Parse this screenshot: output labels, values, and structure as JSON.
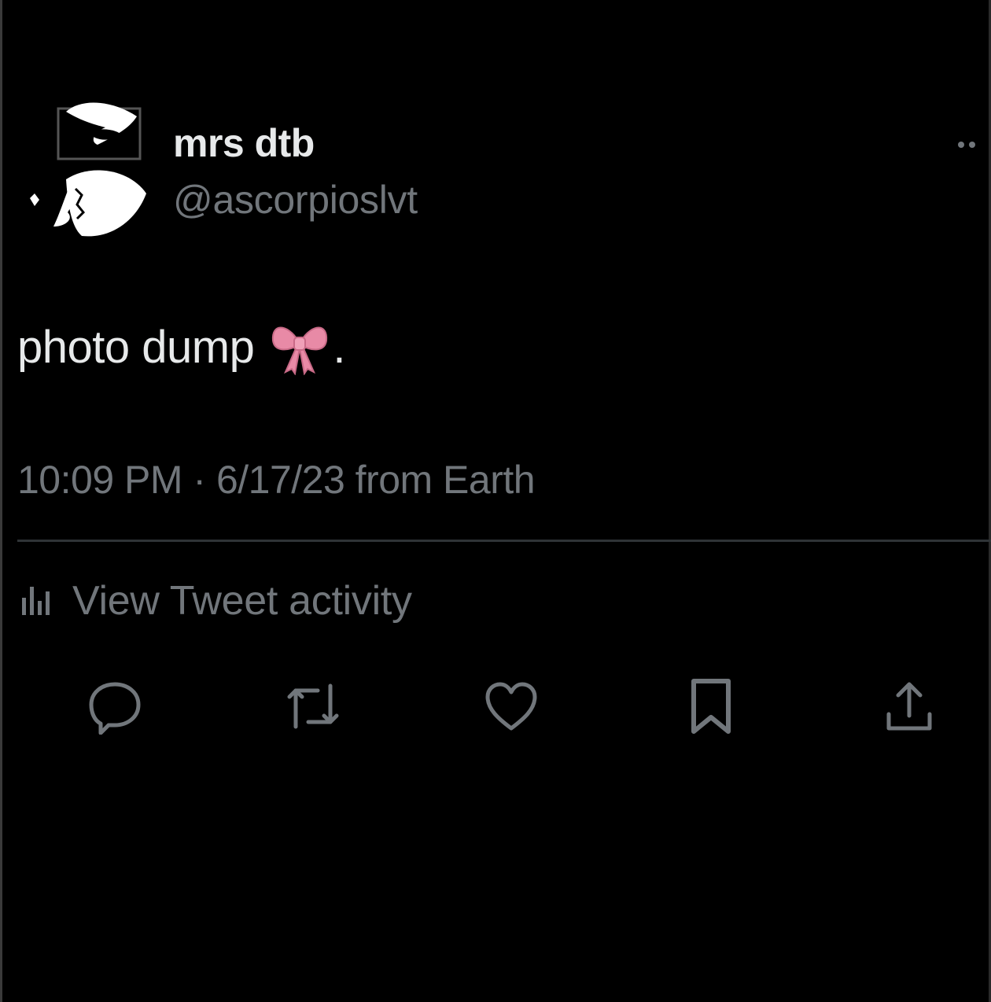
{
  "tweet": {
    "display_name": "mrs dtb",
    "handle": "@ascorpioslvt",
    "text": "photo dump",
    "text_suffix": ".",
    "emoji": "bow-emoji",
    "meta": "10:09 PM · 6/17/23 from Earth"
  },
  "activity": {
    "label": "View Tweet activity",
    "icon": "chart-bars-icon"
  },
  "actions": [
    {
      "name": "reply",
      "icon": "reply-icon"
    },
    {
      "name": "retweet",
      "icon": "retweet-icon"
    },
    {
      "name": "like",
      "icon": "heart-icon"
    },
    {
      "name": "bookmark",
      "icon": "bookmark-icon"
    },
    {
      "name": "share",
      "icon": "share-icon"
    }
  ],
  "colors": {
    "background": "#000000",
    "primary_text": "#e7e9ea",
    "secondary_text": "#71767b",
    "divider": "#2f3336",
    "bow_pink": "#e88aa6"
  }
}
